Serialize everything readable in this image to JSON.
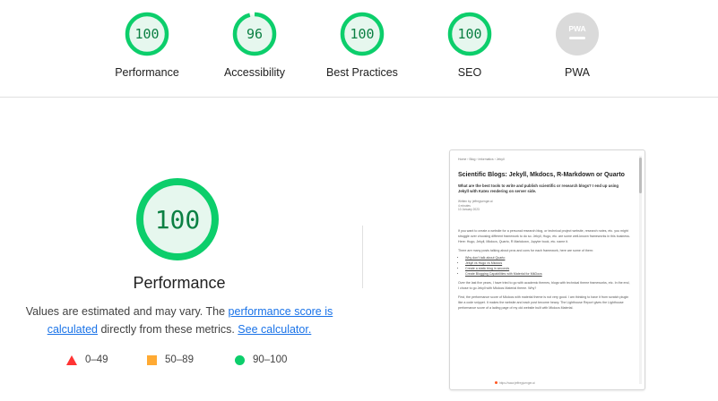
{
  "colors": {
    "pass": "#0cce6b",
    "pass_text": "#0b8043",
    "pass_fill": "#e6f7ee",
    "average": "#ffaa33",
    "fail": "#ff3333",
    "pwa_gray": "#dadada",
    "link": "#1a73e8"
  },
  "categories": [
    {
      "label": "Performance",
      "score": "100",
      "fraction": 1.0
    },
    {
      "label": "Accessibility",
      "score": "96",
      "fraction": 0.96
    },
    {
      "label": "Best Practices",
      "score": "100",
      "fraction": 1.0
    },
    {
      "label": "SEO",
      "score": "100",
      "fraction": 1.0
    },
    {
      "label": "PWA",
      "icon": "pwa-badge-icon",
      "badge_text": "PWA"
    }
  ],
  "main": {
    "score": "100",
    "fraction": 1.0,
    "title": "Performance",
    "desc_prefix": "Values are estimated and may vary. The ",
    "desc_link1": "performance score is calculated",
    "desc_middle": " directly from these metrics. ",
    "desc_link2": "See calculator."
  },
  "legend": [
    {
      "icon": "fail-triangle-icon",
      "range": "0–49"
    },
    {
      "icon": "average-square-icon",
      "range": "50–89"
    },
    {
      "icon": "pass-circle-icon",
      "range": "90–100"
    }
  ],
  "screenshot": {
    "crumb": "Home › Blog › Informatics › Jekyll",
    "title": "Scientific Blogs: Jekyll, Mkdocs, R-Markdown or Quarto",
    "subtitle": "What are the best tools to write and publish scientific or research blogs? I end up using Jekyll with Katex rendering on server side.",
    "meta": [
      "Written by: jeffreyjuenger.ai",
      "4 minutes",
      "10 January 2023"
    ],
    "para1": "If you want to create a website for a personal research blog, or technical project website, research notes, etc. you might struggle over choosing different framework to do so. Jekyll, Hugo, etc. are some well-known frameworks in this business. Here: Hugo, Jekyll, Mkdocs, Quarto, R Markdown, Jupyter book, etc. name it.",
    "para2": "There are many posts talking about pros and cons for each framework, here are some of them:",
    "links": [
      "Why don't talk about Quarto",
      "Jekyll vs Hugo vs Mkdocs",
      "Create a static blog in seconds",
      "Create Blogging Capabilities with Material for MkDocs"
    ],
    "para3": "Over the last five years, I have tried to go with academic themes, blogs with technical theme frameworks, etc. In the end, I chose to go Jekyll with Mkdocs Material theme. Why?",
    "para4": "First, the performance score of Mkdocs with material theme is not very good. I am thinking to have it from scratch plugin like a code snippet. It makes the website and each post become heavy. The Lighthouse Report gives the Lighthouse performance score of a lading page of my old website built with Mkdocs Material.",
    "footer": "https://www.jeffreyjuenger.ai"
  }
}
